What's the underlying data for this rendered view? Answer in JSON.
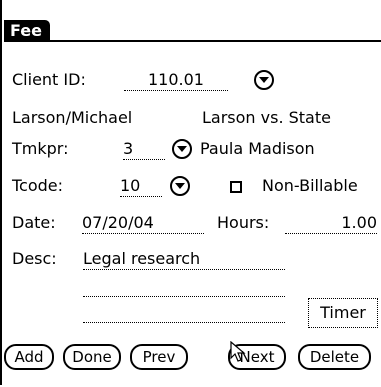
{
  "title": "Fee",
  "client": {
    "label": "Client ID:",
    "value": "110.01",
    "name": "Larson/Michael",
    "matter": "Larson vs. State"
  },
  "timekeeper": {
    "label": "Tmkpr:",
    "value": "3",
    "name": "Paula Madison"
  },
  "tcode": {
    "label": "Tcode:",
    "value": "10"
  },
  "non_billable": {
    "label": "Non-Billable",
    "checked": false
  },
  "date": {
    "label": "Date:",
    "value": "07/20/04"
  },
  "hours": {
    "label": "Hours:",
    "value": "1.00"
  },
  "desc": {
    "label": "Desc:",
    "value": "Legal research"
  },
  "buttons": {
    "timer": "Timer",
    "add": "Add",
    "done": "Done",
    "prev": "Prev",
    "next": "Next",
    "delete": "Delete"
  }
}
